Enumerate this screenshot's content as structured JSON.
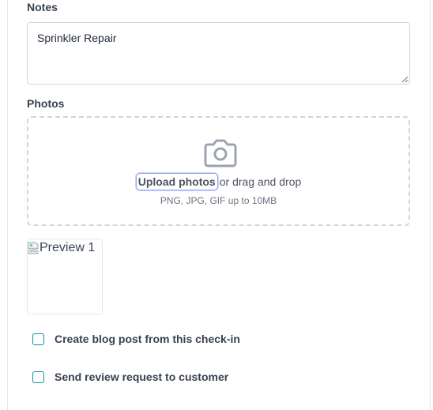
{
  "notes": {
    "label": "Notes",
    "value": "Sprinkler Repair"
  },
  "photos": {
    "label": "Photos",
    "icon": "camera-icon",
    "upload_link": "Upload photos",
    "drag_text": "or drag and drop",
    "hint": "PNG, JPG, GIF up to 10MB",
    "previews": [
      {
        "alt": "Preview 1"
      }
    ]
  },
  "options": [
    {
      "label": "Create blog post from this check-in",
      "checked": false
    },
    {
      "label": "Send review request to customer",
      "checked": false
    }
  ],
  "colors": {
    "checkbox_border": "#0d8fa6",
    "focus_ring": "#93a5e6",
    "dashed_border": "#d1d5db"
  }
}
